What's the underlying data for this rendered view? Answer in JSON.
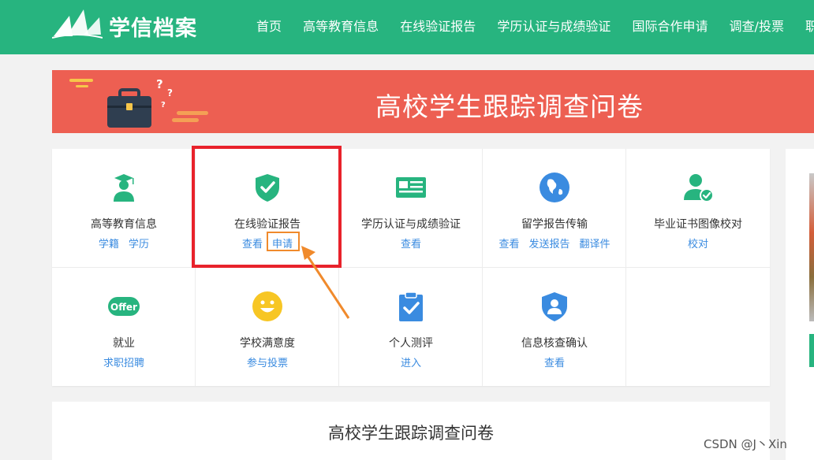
{
  "header": {
    "logo_text": "学信档案",
    "nav": [
      "首页",
      "高等教育信息",
      "在线验证报告",
      "学历认证与成绩验证",
      "国际合作申请",
      "调查/投票",
      "职业"
    ]
  },
  "banner": {
    "title": "高校学生跟踪调查问卷"
  },
  "services": [
    {
      "name": "高等教育信息",
      "links": [
        "学籍",
        "学历"
      ],
      "icon": "graduate-icon"
    },
    {
      "name": "在线验证报告",
      "links": [
        "查看",
        "申请"
      ],
      "icon": "shield-check-icon"
    },
    {
      "name": "学历认证与成绩验证",
      "links": [
        "查看"
      ],
      "icon": "certificate-card-icon"
    },
    {
      "name": "留学报告传输",
      "links": [
        "查看",
        "发送报告",
        "翻译件"
      ],
      "icon": "globe-icon"
    },
    {
      "name": "毕业证书图像校对",
      "links": [
        "校对"
      ],
      "icon": "user-check-icon"
    },
    {
      "name": "就业",
      "links": [
        "求职招聘"
      ],
      "icon": "offer-icon"
    },
    {
      "name": "学校满意度",
      "links": [
        "参与投票"
      ],
      "icon": "smiley-icon"
    },
    {
      "name": "个人测评",
      "links": [
        "进入"
      ],
      "icon": "clipboard-check-icon"
    },
    {
      "name": "信息核查确认",
      "links": [
        "查看"
      ],
      "icon": "shield-user-icon"
    }
  ],
  "offer_badge": "Offer",
  "survey": {
    "title": "高校学生跟踪调查问卷"
  },
  "watermark": "CSDN @J丶Xin",
  "colors": {
    "brand": "#27b47f",
    "banner": "#ed5f52",
    "link": "#3a8be0",
    "highlight_red": "#e8222b",
    "highlight_orange": "#f08a2c"
  }
}
